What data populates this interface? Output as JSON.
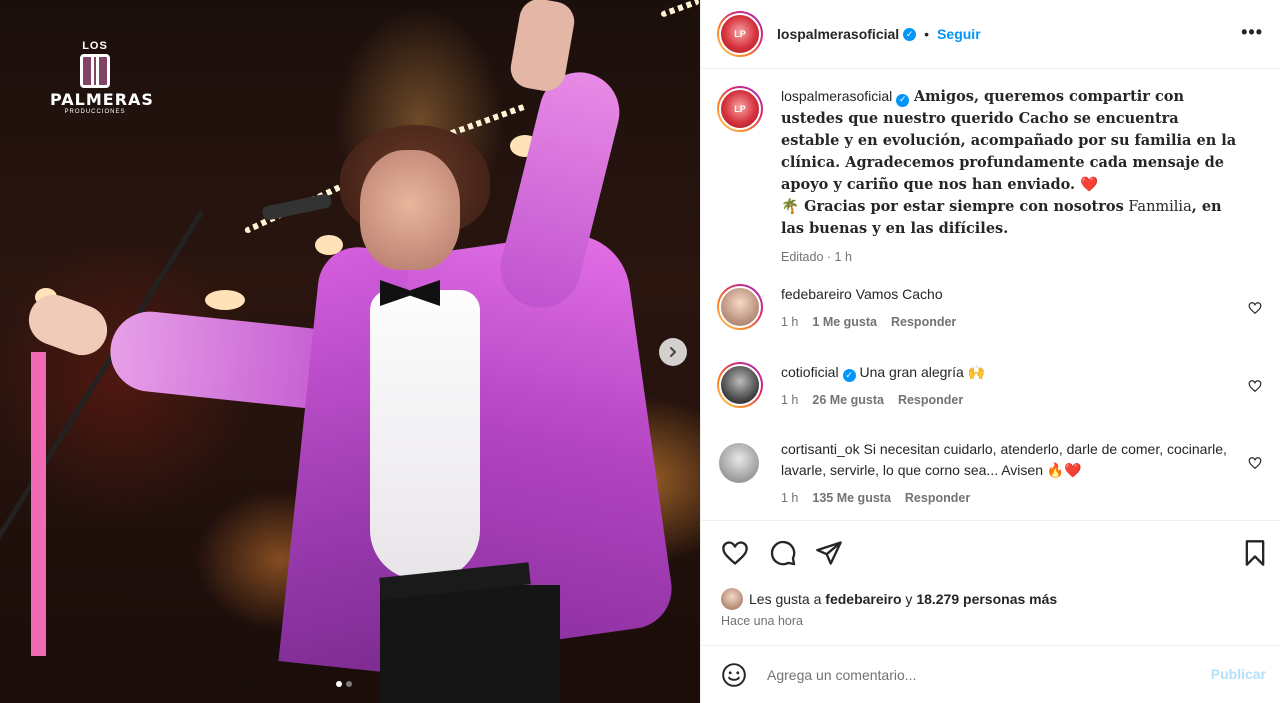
{
  "media": {
    "logo": {
      "los": "LOS",
      "palmeras": "PALMERAS",
      "producciones": "PRODUCCIONES"
    },
    "next_icon": "chevron-right-icon",
    "carousel": {
      "total": 2,
      "active": 1
    }
  },
  "header": {
    "username": "lospalmerasoficial",
    "verified_icon": "verified-badge-icon",
    "separator": "•",
    "follow_label": "Seguir",
    "more_label": "•••"
  },
  "caption": {
    "username": "lospalmerasoficial",
    "text_part1": "Amigos, queremos compartir con ustedes que nuestro querido Cacho se encuentra estable y en evolución, acompañado por su familia en la clínica. Agradecemos profundamente cada mensaje de apoyo y cariño que nos han enviado. ❤️",
    "text_part2": "🌴 Gracias por estar siempre con nosotros",
    "text_part3": "Fanmilia",
    "text_part4": ", en las buenas y en las difíciles.",
    "edited": "Editado",
    "dot": "·",
    "time": "1 h"
  },
  "comments": [
    {
      "username": "fedebareiro",
      "verified": false,
      "text": "Vamos Cacho",
      "time": "1 h",
      "likes": "1 Me gusta",
      "reply": "Responder"
    },
    {
      "username": "cotioficial",
      "verified": true,
      "text": "Una gran alegría 🙌",
      "time": "1 h",
      "likes": "26 Me gusta",
      "reply": "Responder"
    },
    {
      "username": "cortisanti_ok",
      "verified": false,
      "text": "Si necesitan cuidarlo, atenderlo, darle de comer, cocinarle, lavarle, servirle, lo que corno sea... Avisen 🔥❤️",
      "time": "1 h",
      "likes": "135 Me gusta",
      "reply": "Responder"
    }
  ],
  "actions": {
    "like_icon": "heart-icon",
    "comment_icon": "comment-icon",
    "share_icon": "send-icon",
    "save_icon": "bookmark-icon"
  },
  "likes": {
    "prefix": "Les gusta a",
    "user": "fedebareiro",
    "middle": "y",
    "count": "18.279 personas más"
  },
  "posted": "Hace una hora",
  "composer": {
    "emoji_icon": "emoji-icon",
    "placeholder": "Agrega un comentario...",
    "publish_label": "Publicar"
  },
  "colors": {
    "accent": "#0095f6",
    "publish_disabled": "#b2dffc",
    "pink_bar": "#f06bb3"
  }
}
